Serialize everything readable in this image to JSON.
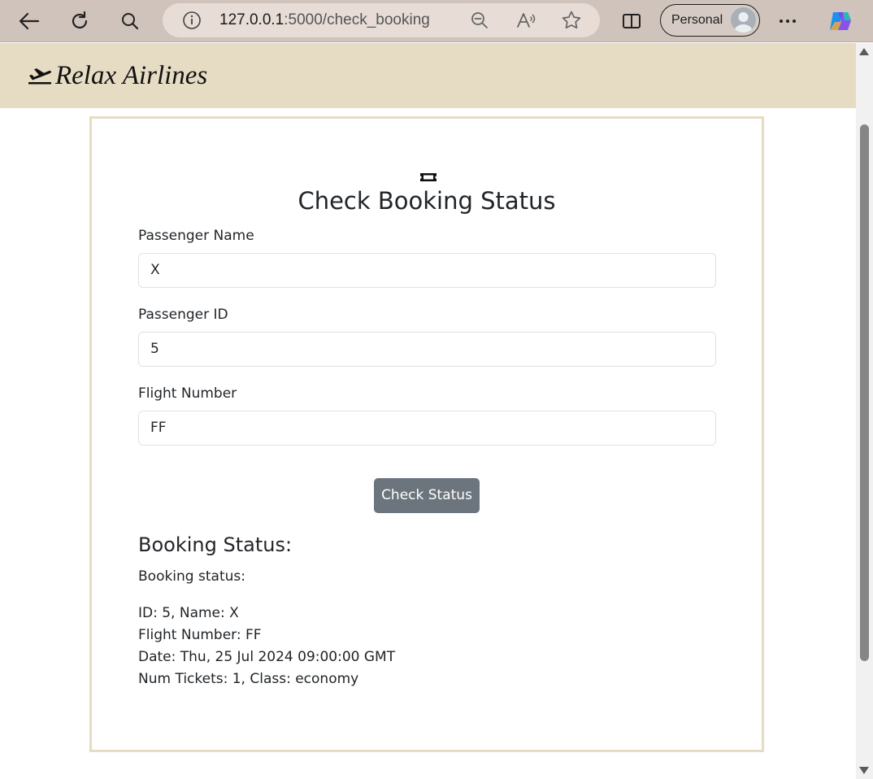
{
  "browser": {
    "url_host": "127.0.0.1",
    "url_rest": ":5000/check_booking",
    "profile_label": "Personal"
  },
  "app": {
    "brand": "Relax Airlines"
  },
  "form": {
    "title": "Check Booking Status",
    "fields": [
      {
        "label": "Passenger Name",
        "value": "X"
      },
      {
        "label": "Passenger ID",
        "value": "5"
      },
      {
        "label": "Flight Number",
        "value": "FF"
      }
    ],
    "submit_label": "Check Status"
  },
  "result": {
    "heading": "Booking Status:",
    "intro": "Booking status:",
    "lines": [
      "ID: 5, Name: X",
      "Flight Number: FF",
      "Date: Thu, 25 Jul 2024 09:00:00 GMT",
      "Num Tickets: 1, Class: economy"
    ]
  },
  "colors": {
    "header_bg": "#e6dcc4",
    "button_bg": "#6c757d",
    "chrome_bg": "#cfc3bb"
  }
}
